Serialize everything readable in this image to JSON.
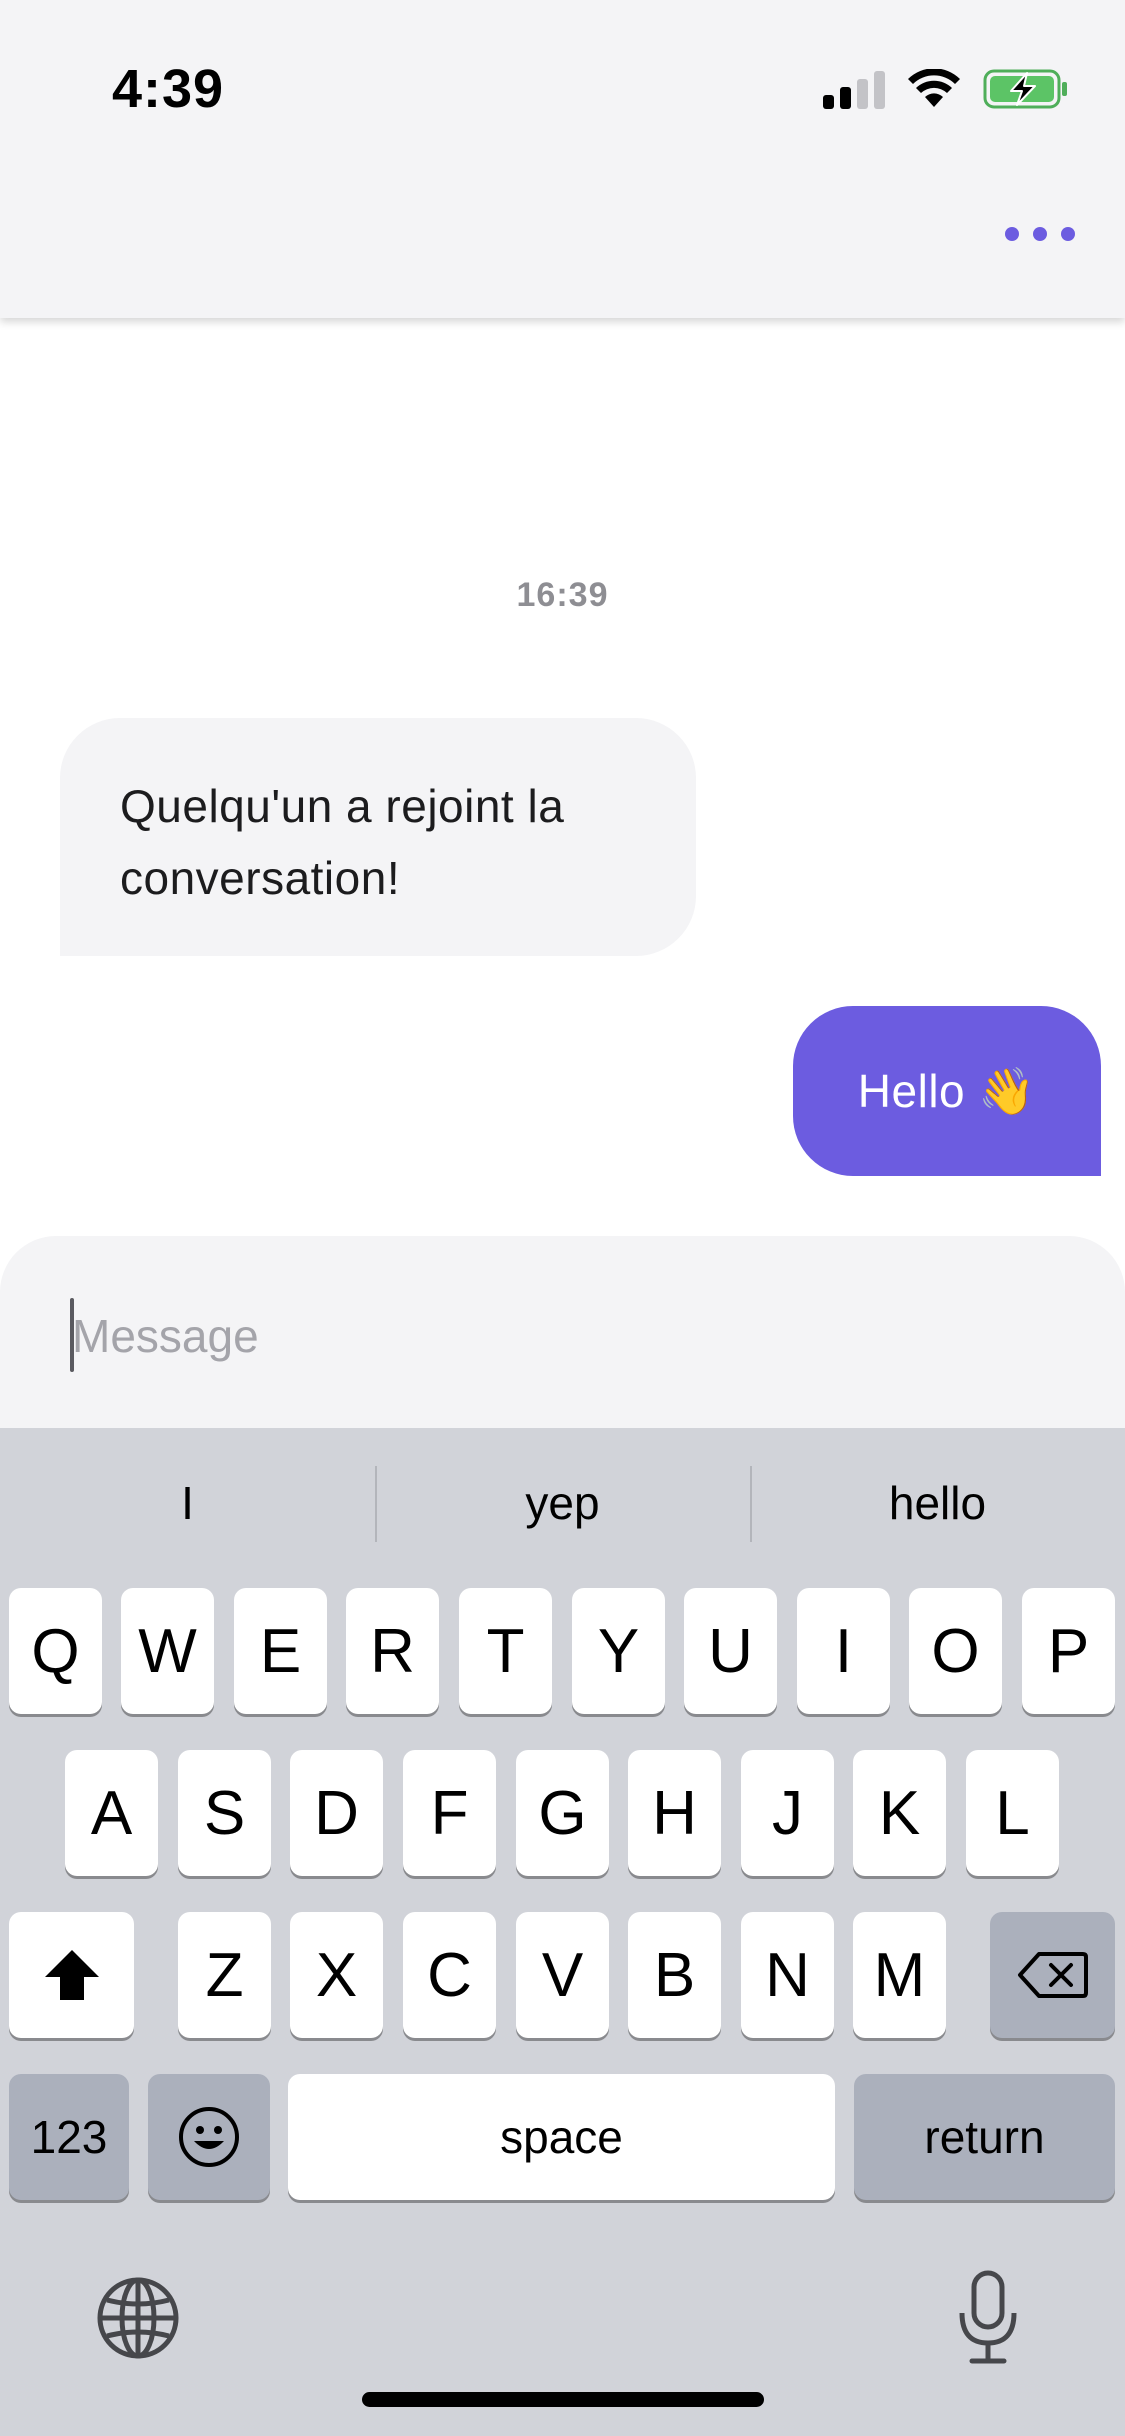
{
  "status_bar": {
    "time": "4:39",
    "icons": [
      "signal-icon",
      "wifi-icon",
      "battery-charging-icon"
    ],
    "signal_bars_filled": 2,
    "signal_bars_total": 4
  },
  "header": {
    "more_icon": "more-horizontal-icon",
    "accent_color": "#6c5ce0"
  },
  "conversation": {
    "timestamp": "16:39",
    "messages": [
      {
        "direction": "incoming",
        "text_line1": "Quelqu'un a rejoint la",
        "text_line2": "conversation!"
      },
      {
        "direction": "outgoing",
        "text": "Hello 👋"
      }
    ]
  },
  "composer": {
    "placeholder": "Message",
    "value": ""
  },
  "keyboard": {
    "suggestions": [
      "I",
      "yep",
      "hello"
    ],
    "row1": [
      "Q",
      "W",
      "E",
      "R",
      "T",
      "Y",
      "U",
      "I",
      "O",
      "P"
    ],
    "row2": [
      "A",
      "S",
      "D",
      "F",
      "G",
      "H",
      "J",
      "K",
      "L"
    ],
    "row3": [
      "Z",
      "X",
      "C",
      "V",
      "B",
      "N",
      "M"
    ],
    "numbers_label": "123",
    "space_label": "space",
    "return_label": "return",
    "icons": [
      "shift-icon",
      "backspace-icon",
      "emoji-icon",
      "globe-icon",
      "microphone-icon"
    ]
  }
}
